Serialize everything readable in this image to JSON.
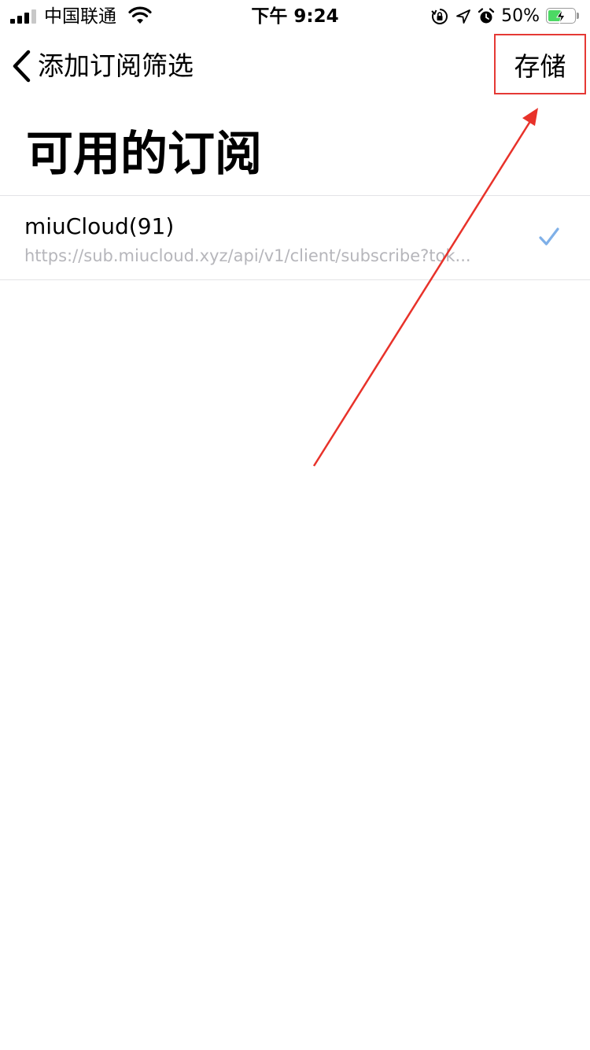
{
  "status_bar": {
    "carrier": "中国联通",
    "time": "下午 9:24",
    "battery_percent": "50%",
    "battery_level": 0.5,
    "icons": [
      "signal-icon",
      "wifi-icon",
      "orientation-lock-icon",
      "location-icon",
      "alarm-icon",
      "battery-icon",
      "charging-bolt-icon"
    ]
  },
  "nav": {
    "back_icon": "chevron-left-icon",
    "back_label": "添加订阅筛选",
    "save_label": "存储"
  },
  "page": {
    "title": "可用的订阅"
  },
  "subscriptions": [
    {
      "name": "miuCloud(91)",
      "url": "https://sub.miucloud.xyz/api/v1/client/subscribe?tok...",
      "selected": true,
      "check_icon": "checkmark-icon"
    }
  ],
  "colors": {
    "highlight_red": "#e53935",
    "check_blue": "#7fb0e8",
    "battery_green": "#4cd964",
    "subtitle_gray": "#b6b6bb"
  }
}
